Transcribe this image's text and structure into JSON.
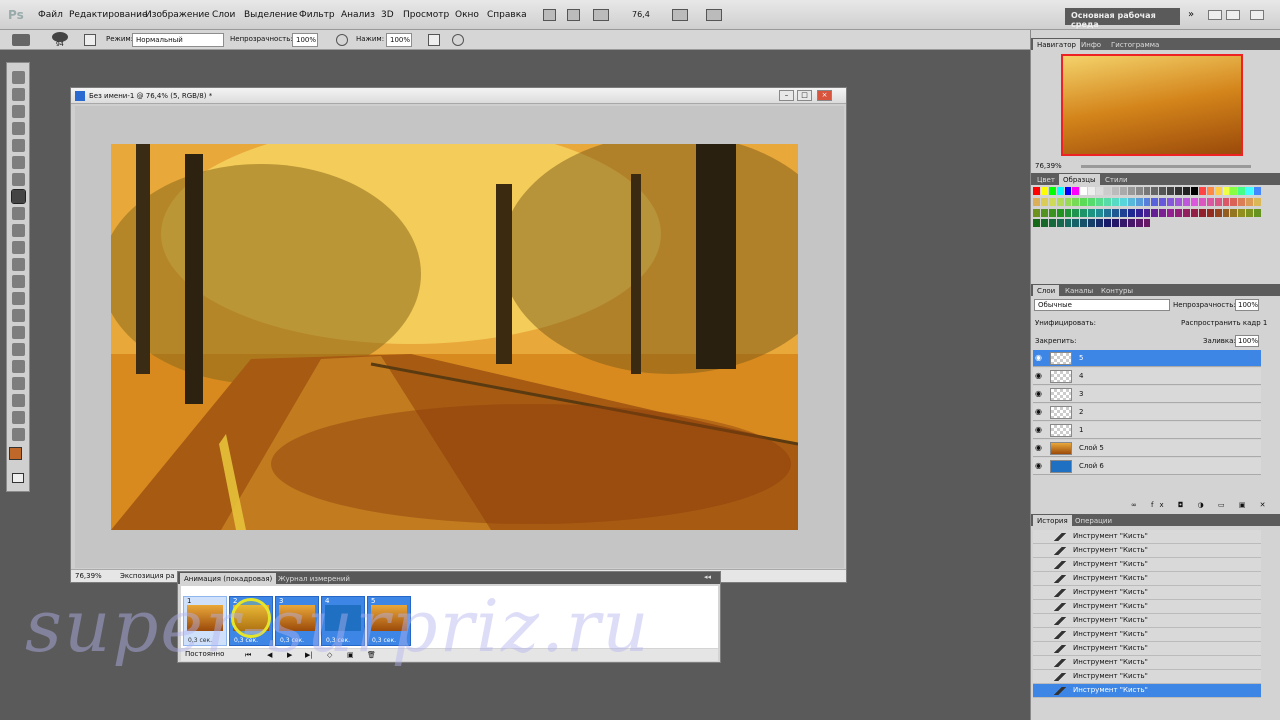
{
  "app": {
    "logo": "Ps",
    "workspace": "Основная рабочая среда",
    "zoom": "76,4"
  },
  "menu": [
    "Файл",
    "Редактирование",
    "Изображение",
    "Слои",
    "Выделение",
    "Фильтр",
    "Анализ",
    "3D",
    "Просмотр",
    "Окно",
    "Справка"
  ],
  "options": {
    "brush_size": "94",
    "mode_label": "Режим:",
    "mode_value": "Нормальный",
    "opacity_label": "Непрозрачность:",
    "opacity_value": "100%",
    "flow_label": "Нажим:",
    "flow_value": "100%"
  },
  "document": {
    "title": "Без имени-1 @ 76,4% (5, RGB/8) *",
    "status_zoom": "76,39%",
    "status_text": "Экспозиция ра"
  },
  "animation": {
    "tabs": [
      "Анимация (покадровая)",
      "Журнал измерений"
    ],
    "frames": [
      {
        "num": "1",
        "delay": "0,3 сек.",
        "kind": "photo"
      },
      {
        "num": "2",
        "delay": "0,3 сек.",
        "kind": "photo"
      },
      {
        "num": "3",
        "delay": "0,3 сек.",
        "kind": "photo"
      },
      {
        "num": "4",
        "delay": "0,3 сек.",
        "kind": "blue"
      },
      {
        "num": "5",
        "delay": "0,3 сек.",
        "kind": "photo"
      }
    ],
    "loop": "Постоянно"
  },
  "watermark": "super-surpriz.ru",
  "navigator": {
    "tabs": [
      "Навигатор",
      "Инфо",
      "Гистограмма"
    ],
    "zoom": "76,39%"
  },
  "swatches_panel": {
    "tabs": [
      "Цвет",
      "Образцы",
      "Стили"
    ]
  },
  "layers_panel": {
    "tabs": [
      "Слои",
      "Каналы",
      "Контуры"
    ],
    "blend": "Обычные",
    "opacity_label": "Непрозрачность:",
    "opacity_value": "100%",
    "unify_label": "Унифицировать:",
    "propagate_label": "Распространить кадр 1",
    "lock_label": "Закрепить:",
    "fill_label": "Заливка:",
    "fill_value": "100%",
    "layers": [
      {
        "name": "5",
        "thumb": "transparent",
        "selected": true
      },
      {
        "name": "4",
        "thumb": "transparent",
        "selected": false
      },
      {
        "name": "3",
        "thumb": "transparent",
        "selected": false
      },
      {
        "name": "2",
        "thumb": "transparent",
        "selected": false
      },
      {
        "name": "1",
        "thumb": "transparent",
        "selected": false
      },
      {
        "name": "Слой 5",
        "thumb": "photo",
        "selected": false
      },
      {
        "name": "Слой 6",
        "thumb": "blue",
        "selected": false
      }
    ]
  },
  "history_panel": {
    "tabs": [
      "История",
      "Операции"
    ],
    "items": [
      "Инструмент \"Кисть\"",
      "Инструмент \"Кисть\"",
      "Инструмент \"Кисть\"",
      "Инструмент \"Кисть\"",
      "Инструмент \"Кисть\"",
      "Инструмент \"Кисть\"",
      "Инструмент \"Кисть\"",
      "Инструмент \"Кисть\"",
      "Инструмент \"Кисть\"",
      "Инструмент \"Кисть\"",
      "Инструмент \"Кисть\"",
      "Инструмент \"Кисть\""
    ]
  },
  "colors": {
    "foreground": "#c0672a",
    "background": "#e8c9a8",
    "selection": "#3d86e6"
  }
}
